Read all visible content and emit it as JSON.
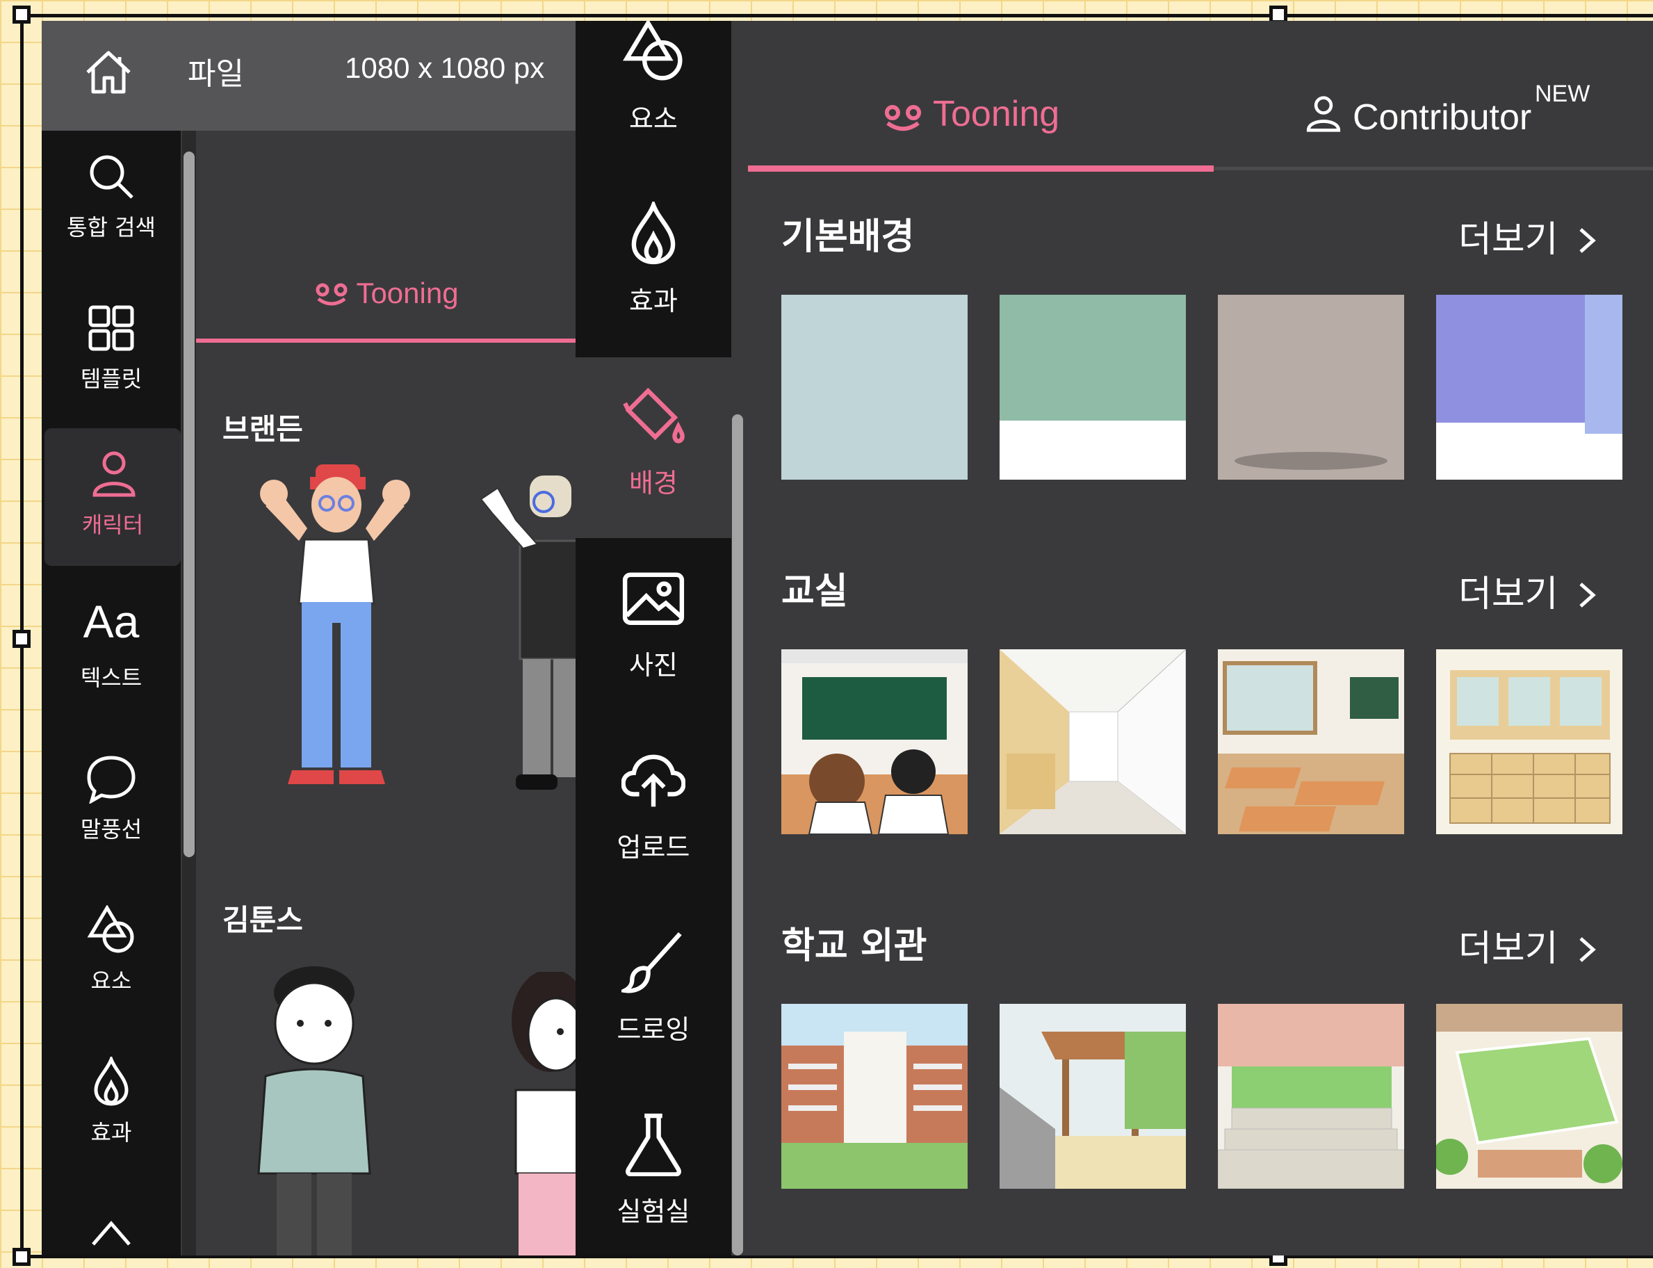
{
  "topbar": {
    "file_label": "파일",
    "size_label": "1080 x 1080 px"
  },
  "left_nav": [
    {
      "label": "통합 검색",
      "icon": "search-icon"
    },
    {
      "label": "템플릿",
      "icon": "grid-icon"
    },
    {
      "label": "캐릭터",
      "icon": "person-icon",
      "active": true
    },
    {
      "label": "텍스트",
      "icon": "text-icon"
    },
    {
      "label": "말풍선",
      "icon": "speech-bubble-icon"
    },
    {
      "label": "요소",
      "icon": "shapes-icon"
    },
    {
      "label": "효과",
      "icon": "flame-icon"
    }
  ],
  "left_panel": {
    "tab_label": "Tooning",
    "sections": [
      "브랜든",
      "김툰스"
    ]
  },
  "middle_nav": [
    {
      "label": "요소",
      "icon": "shapes-icon"
    },
    {
      "label": "효과",
      "icon": "flame-icon"
    },
    {
      "label": "배경",
      "icon": "paint-bucket-icon",
      "active": true
    },
    {
      "label": "사진",
      "icon": "image-icon"
    },
    {
      "label": "업로드",
      "icon": "cloud-upload-icon"
    },
    {
      "label": "드로잉",
      "icon": "brush-icon"
    },
    {
      "label": "실험실",
      "icon": "flask-icon"
    }
  ],
  "right_panel": {
    "tabs": [
      {
        "label": "Tooning",
        "active": true
      },
      {
        "label": "Contributor",
        "badge": "NEW"
      }
    ],
    "sections": [
      {
        "title": "기본배경",
        "more_label": "더보기"
      },
      {
        "title": "교실",
        "more_label": "더보기"
      },
      {
        "title": "학교 외관",
        "more_label": "더보기"
      }
    ]
  },
  "colors": {
    "accent": "#ef6d93",
    "sidebar": "#141414",
    "panel": "#3a3a3c",
    "topbar": "#555557",
    "canvas_grid_bg": "#fdf0c4"
  }
}
